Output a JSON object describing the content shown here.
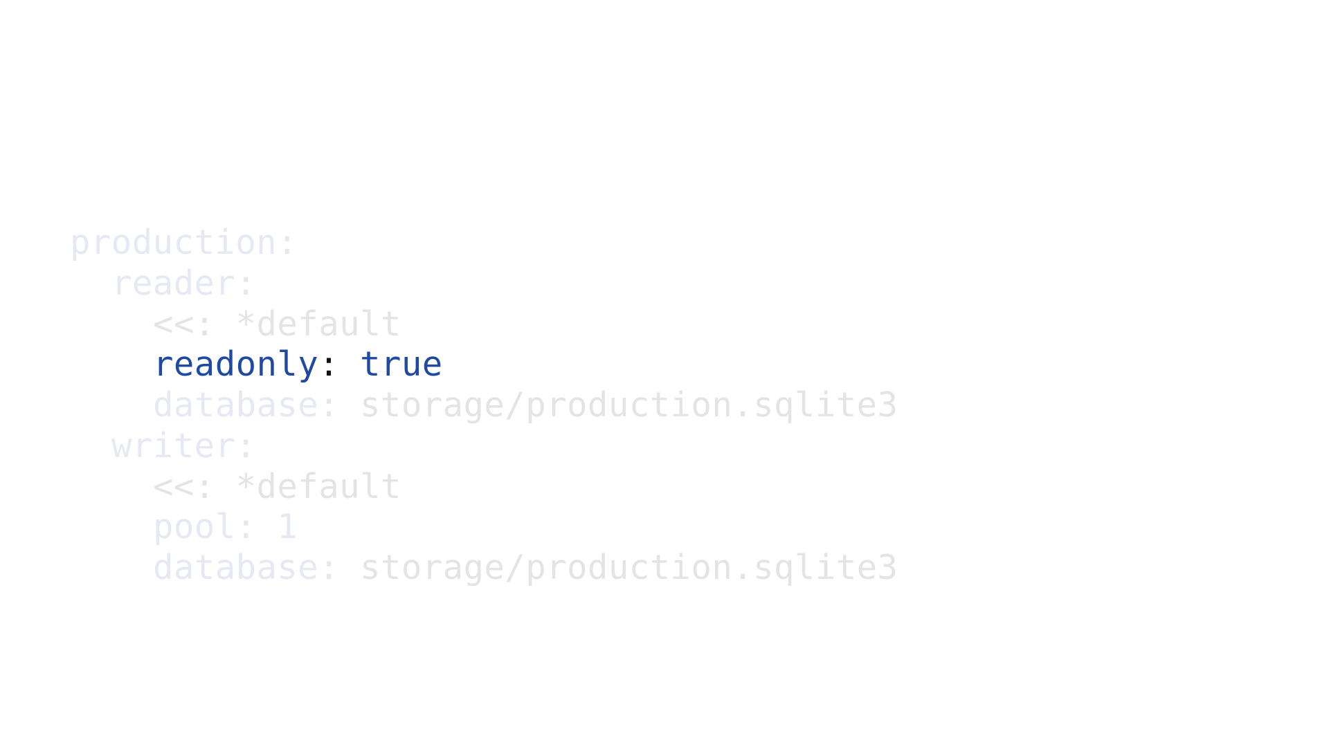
{
  "colors": {
    "background": "#ffffff",
    "focus_key": "#1f49a3",
    "focus_value": "#1f49a3",
    "focus_punctuation": "#111111",
    "dim_key": "#e6e9f4",
    "dim_text": "#e4e4e4"
  },
  "code": {
    "language": "yaml",
    "highlighted_line": 4,
    "lines": [
      {
        "key": "production",
        "sep": ":",
        "value": ""
      },
      {
        "key": "reader",
        "sep": ":",
        "value": ""
      },
      {
        "key": "",
        "sep": "<<:",
        "value": " *default"
      },
      {
        "key": "readonly",
        "sep": ":",
        "value": " true"
      },
      {
        "key": "database",
        "sep": ":",
        "value": " storage/production.sqlite3"
      },
      {
        "key": "writer",
        "sep": ":",
        "value": ""
      },
      {
        "key": "",
        "sep": "<<:",
        "value": " *default"
      },
      {
        "key": "pool",
        "sep": ":",
        "value": " 1"
      },
      {
        "key": "database",
        "sep": ":",
        "value": " storage/production.sqlite3"
      }
    ]
  }
}
